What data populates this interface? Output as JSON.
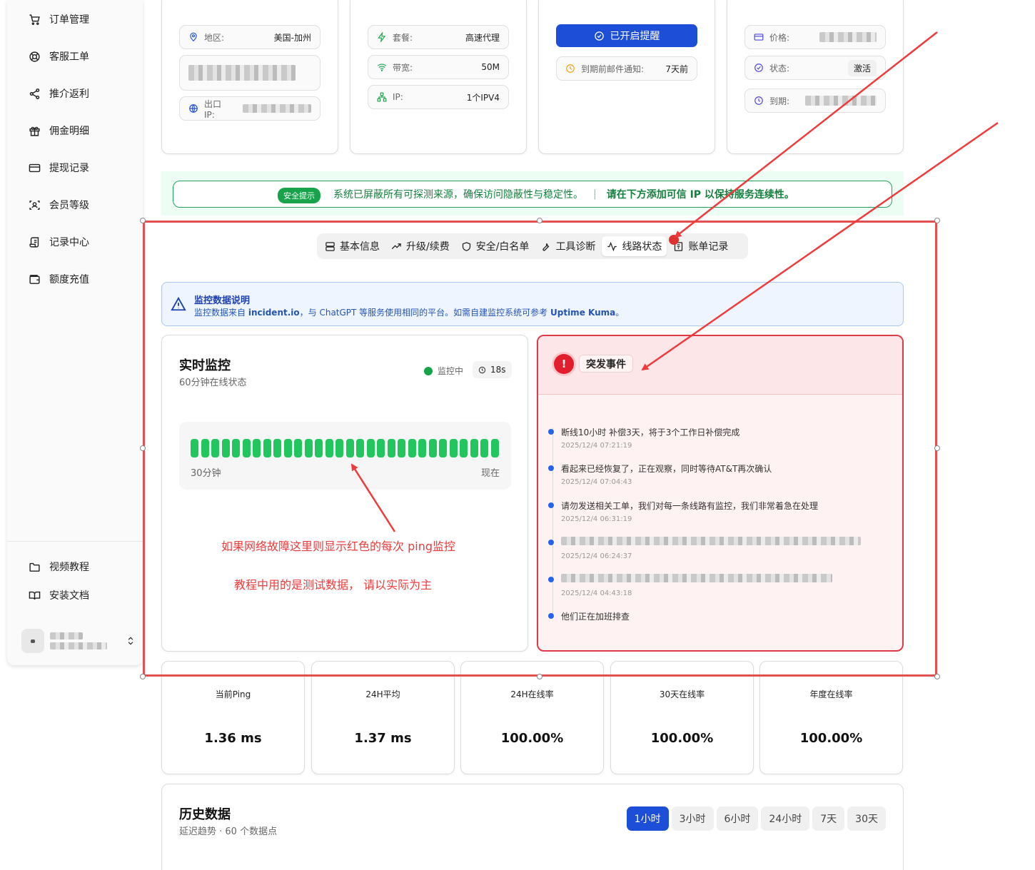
{
  "sidebar": {
    "items": [
      {
        "label": "订单管理",
        "icon": "cart-icon"
      },
      {
        "label": "客服工单",
        "icon": "lifebuoy-icon"
      },
      {
        "label": "推介返利",
        "icon": "share-icon"
      },
      {
        "label": "佣金明细",
        "icon": "gift-icon"
      },
      {
        "label": "提现记录",
        "icon": "credit-card-icon"
      },
      {
        "label": "会员等级",
        "icon": "scan-face-icon"
      },
      {
        "label": "记录中心",
        "icon": "scroll-icon"
      },
      {
        "label": "额度充值",
        "icon": "wallet-icon"
      }
    ],
    "bottom_items": [
      {
        "label": "视频教程",
        "icon": "folder-icon"
      },
      {
        "label": "安装文档",
        "icon": "book-icon"
      }
    ]
  },
  "cards": {
    "location": {
      "region_label": "地区:",
      "region_value": "美国-加州",
      "exit_ip_label": "出口 IP:"
    },
    "plan": {
      "package_label": "套餐:",
      "package_value": "高速代理",
      "bandwidth_label": "带宽:",
      "bandwidth_value": "50M",
      "ip_label": "IP:",
      "ip_value": "1个IPV4"
    },
    "reminder": {
      "button_label": "已开启提醒",
      "notice_label": "到期前邮件通知:",
      "notice_value": "7天前"
    },
    "billing": {
      "price_label": "价格:",
      "status_label": "状态:",
      "status_value": "激活",
      "expiry_label": "到期:"
    }
  },
  "security": {
    "badge": "安全提示",
    "text": "系统已屏蔽所有可探测来源，确保访问隐蔽性与稳定性。",
    "separator": "|",
    "strong_text": "请在下方添加可信 IP 以保持服务连续性。"
  },
  "tabs": [
    {
      "label": "基本信息",
      "icon": "server-icon"
    },
    {
      "label": "升级/续费",
      "icon": "trending-up-icon"
    },
    {
      "label": "安全/白名单",
      "icon": "shield-icon"
    },
    {
      "label": "工具诊断",
      "icon": "wrench-icon"
    },
    {
      "label": "线路状态",
      "icon": "activity-icon"
    },
    {
      "label": "账单记录",
      "icon": "receipt-icon"
    }
  ],
  "active_tab": "线路状态",
  "info_banner": {
    "title": "监控数据说明",
    "desc_prefix": "监控数据来自 ",
    "desc_source": "incident.io",
    "desc_middle": "，与 ChatGPT 等服务使用相同的平台。如需自建监控系统可参考 ",
    "desc_ref": "Uptime Kuma",
    "desc_suffix": "。"
  },
  "monitor": {
    "title": "实时监控",
    "subtitle": "60分钟在线状态",
    "status": "监控中",
    "timer": "18s",
    "bar_count": 30,
    "bar_status": "online",
    "bar_color": "#22c55e",
    "range_start": "30分钟",
    "range_end": "现在",
    "note1": "如果网络故障这里则显示红色的每次 ping监控",
    "note2": "教程中用的是测试数据， 请以实际为主"
  },
  "incident": {
    "title": "突发事件",
    "events": [
      {
        "text": "断线10小时 补偿3天，将于3个工作日补偿完成",
        "time": "2025/12/4 07:21:19"
      },
      {
        "text": "看起来已经恢复了，正在观察，同时等待AT&T再次确认",
        "time": "2025/12/4 07:04:43"
      },
      {
        "text": "请勿发送相关工单，我们对每一条线路有监控，我们非常着急在处理",
        "time": "2025/12/4 06:31:19"
      },
      {
        "text": "",
        "time": "2025/12/4 06:24:37"
      },
      {
        "text": "",
        "time": "2025/12/4 04:43:18"
      },
      {
        "text": "他们正在加班排查",
        "time": ""
      }
    ]
  },
  "stats": [
    {
      "label": "当前Ping",
      "value": "1.36 ms"
    },
    {
      "label": "24H平均",
      "value": "1.37 ms"
    },
    {
      "label": "24H在线率",
      "value": "100.00%"
    },
    {
      "label": "30天在线率",
      "value": "100.00%"
    },
    {
      "label": "年度在线率",
      "value": "100.00%"
    }
  ],
  "history": {
    "title": "历史数据",
    "subtitle": "延迟趋势 · 60 个数据点",
    "ranges": [
      "1小时",
      "3小时",
      "6小时",
      "24小时",
      "7天",
      "30天"
    ],
    "active_range": "1小时"
  },
  "colors": {
    "accent": "#1d4ed8",
    "online": "#22c55e",
    "danger": "#e03a46",
    "annotation": "#ef3b3b"
  }
}
